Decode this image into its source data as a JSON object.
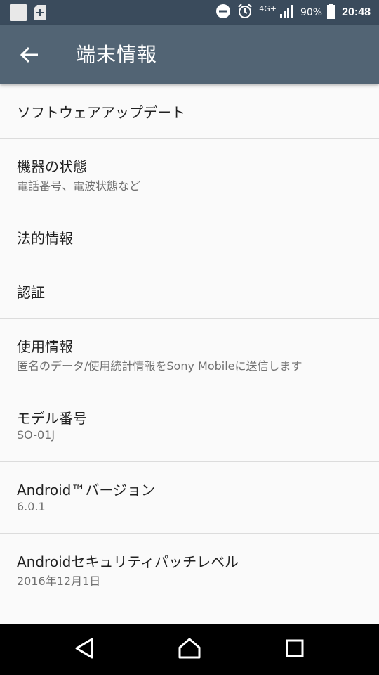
{
  "status_bar": {
    "network": "4G+",
    "battery": "90%",
    "time": "20:48",
    "icons": [
      "notification-square-icon",
      "sd-card-icon",
      "do-not-disturb-icon",
      "alarm-icon",
      "signal-icon",
      "battery-icon"
    ]
  },
  "app_bar": {
    "title": "端末情報",
    "back_icon": "arrow-back-icon"
  },
  "items": [
    {
      "title": "ソフトウェアアップデート"
    },
    {
      "title": "機器の状態",
      "subtitle": "電話番号、電波状態など"
    },
    {
      "title": "法的情報"
    },
    {
      "title": "認証"
    },
    {
      "title": "使用情報",
      "subtitle": "匿名のデータ/使用統計情報をSony Mobileに送信します"
    },
    {
      "title": "モデル番号",
      "subtitle": "SO-01J"
    },
    {
      "title": "Android™バージョン",
      "subtitle": "6.0.1"
    },
    {
      "title": "Androidセキュリティパッチレベル",
      "subtitle": "2016年12月1日"
    }
  ],
  "nav_bar": {
    "icons": [
      "back-triangle-icon",
      "home-icon",
      "recents-icon"
    ]
  },
  "colors": {
    "status_bar": "#3a4b5c",
    "app_bar": "#526474",
    "background": "#fafafa",
    "nav_bar": "#000000"
  }
}
